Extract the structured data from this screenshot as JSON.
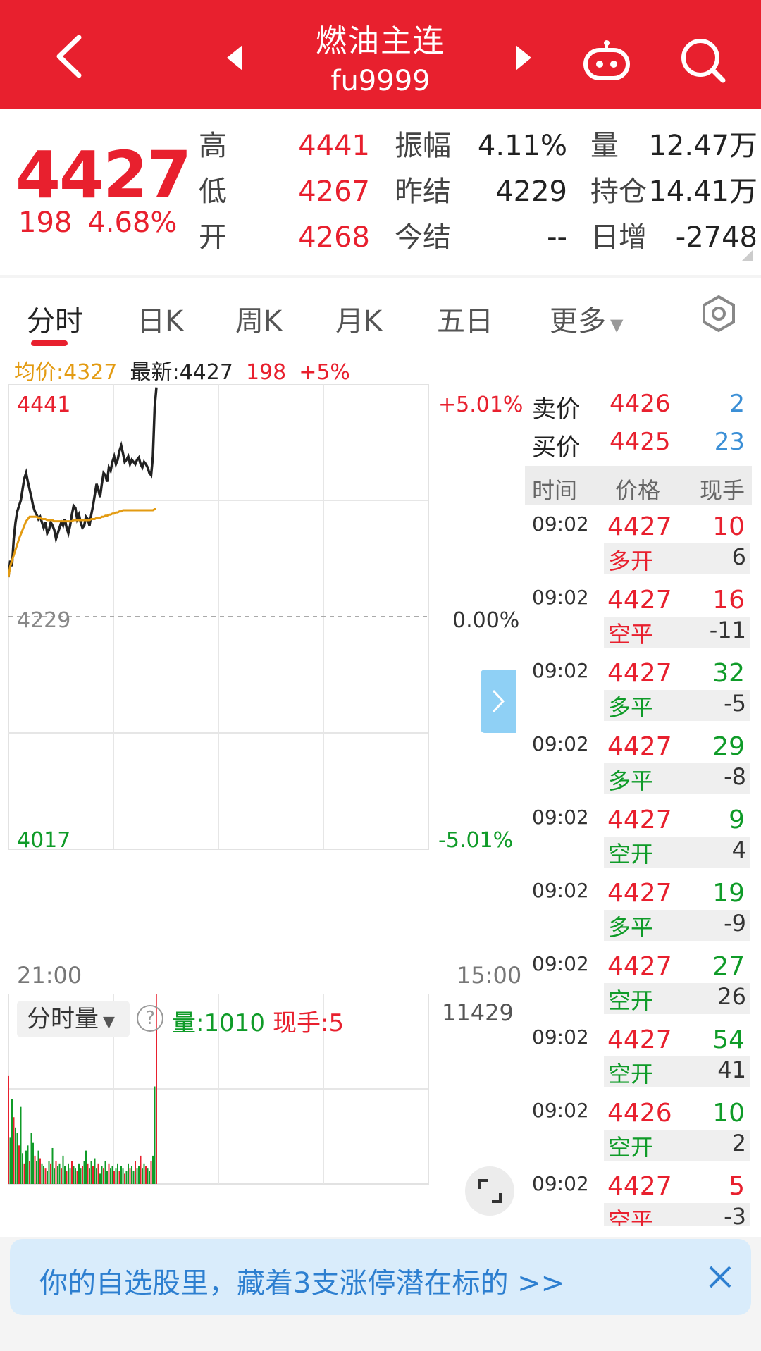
{
  "header": {
    "title": "燃油主连",
    "code": "fu9999",
    "icons": [
      "back-icon",
      "prev-arrow-icon",
      "next-arrow-icon",
      "robot-icon",
      "search-icon"
    ]
  },
  "quote": {
    "price": "4427",
    "change": "198",
    "change_pct": "4.68%",
    "rows": [
      {
        "l1": "高",
        "v1": "4441",
        "l2": "振幅",
        "v2": "4.11%",
        "l3": "量",
        "v3": "12.47万"
      },
      {
        "l1": "低",
        "v1": "4267",
        "l2": "昨结",
        "v2": "4229",
        "l3": "持仓",
        "v3": "14.41万"
      },
      {
        "l1": "开",
        "v1": "4268",
        "l2": "今结",
        "v2": "--",
        "l3": "日增",
        "v3": "-2748"
      }
    ]
  },
  "tabs": [
    "分时",
    "日K",
    "周K",
    "月K",
    "五日",
    "更多"
  ],
  "legend": {
    "avg": "均价:4327",
    "latest": "最新:4427",
    "chg": "198",
    "pct": "+5%"
  },
  "chart": {
    "y_high": "4441",
    "y_mid": "4229",
    "y_low": "4017",
    "pct_high": "+5.01%",
    "pct_mid": "0.00%",
    "pct_low": "-5.01%",
    "t_start": "21:00",
    "t_end": "15:00"
  },
  "volume": {
    "selector": "分时量",
    "qty": "量:1010",
    "hand": "现手:5",
    "max": "11429"
  },
  "orderbook": {
    "sell_label": "卖价",
    "sell_price": "4426",
    "sell_qty": "2",
    "buy_label": "买价",
    "buy_price": "4425",
    "buy_qty": "23",
    "col_time": "时间",
    "col_price": "价格",
    "col_qty": "现手"
  },
  "trades": [
    {
      "time": "09:02",
      "price": "4427",
      "qty": "10",
      "qty_color": "red",
      "type": "多开",
      "type_color": "red",
      "net": "6"
    },
    {
      "time": "09:02",
      "price": "4427",
      "qty": "16",
      "qty_color": "red",
      "type": "空平",
      "type_color": "red",
      "net": "-11"
    },
    {
      "time": "09:02",
      "price": "4427",
      "qty": "32",
      "qty_color": "green",
      "type": "多平",
      "type_color": "green",
      "net": "-5"
    },
    {
      "time": "09:02",
      "price": "4427",
      "qty": "29",
      "qty_color": "green",
      "type": "多平",
      "type_color": "green",
      "net": "-8"
    },
    {
      "time": "09:02",
      "price": "4427",
      "qty": "9",
      "qty_color": "green",
      "type": "空开",
      "type_color": "green",
      "net": "4"
    },
    {
      "time": "09:02",
      "price": "4427",
      "qty": "19",
      "qty_color": "green",
      "type": "多平",
      "type_color": "green",
      "net": "-9"
    },
    {
      "time": "09:02",
      "price": "4427",
      "qty": "27",
      "qty_color": "green",
      "type": "空开",
      "type_color": "green",
      "net": "26"
    },
    {
      "time": "09:02",
      "price": "4427",
      "qty": "54",
      "qty_color": "green",
      "type": "空开",
      "type_color": "green",
      "net": "41"
    },
    {
      "time": "09:02",
      "price": "4426",
      "qty": "10",
      "qty_color": "green",
      "type": "空开",
      "type_color": "green",
      "net": "2"
    },
    {
      "time": "09:02",
      "price": "4427",
      "qty": "5",
      "qty_color": "red",
      "type": "空平",
      "type_color": "red",
      "net": "-3"
    }
  ],
  "banner": {
    "text": "你的自选股里，藏着3支涨停潜在标的 >>"
  },
  "colors": {
    "brand_red": "#e8202e",
    "green": "#0f9b28",
    "avg_line": "#e39b12",
    "blue": "#3b8fd6"
  },
  "chart_data": {
    "type": "line",
    "title": "",
    "xlabel": "",
    "ylabel": "",
    "ylim": [
      4017,
      4441
    ],
    "x_ticks": [
      "21:00",
      "15:00"
    ],
    "series": [
      {
        "name": "最新",
        "values": [
          4265,
          4280,
          4275,
          4300,
          4315,
          4325,
          4330,
          4335,
          4345,
          4355,
          4360,
          4352,
          4345,
          4338,
          4330,
          4325,
          4322,
          4318,
          4320,
          4315,
          4310,
          4315,
          4305,
          4308,
          4315,
          4312,
          4308,
          4300,
          4305,
          4310,
          4315,
          4312,
          4318,
          4310,
          4305,
          4312,
          4322,
          4330,
          4328,
          4318,
          4322,
          4315,
          4310,
          4312,
          4320,
          4318,
          4312,
          4322,
          4330,
          4340,
          4350,
          4345,
          4338,
          4350,
          4360,
          4358,
          4352,
          4365,
          4362,
          4370,
          4375,
          4368,
          4372,
          4380,
          4385,
          4378,
          4370,
          4372,
          4375,
          4368,
          4372,
          4370,
          4368,
          4372,
          4374,
          4368,
          4365,
          4370,
          4368,
          4365,
          4360,
          4358,
          4375,
          4420,
          4438
        ]
      },
      {
        "name": "均价",
        "values": [
          4265,
          4275,
          4280,
          4285,
          4290,
          4295,
          4300,
          4304,
          4308,
          4312,
          4316,
          4318,
          4320,
          4320,
          4320,
          4320,
          4320,
          4319,
          4319,
          4318,
          4318,
          4318,
          4317,
          4317,
          4317,
          4317,
          4316,
          4316,
          4316,
          4316,
          4316,
          4316,
          4316,
          4316,
          4316,
          4316,
          4316,
          4317,
          4317,
          4317,
          4317,
          4317,
          4317,
          4317,
          4317,
          4317,
          4317,
          4318,
          4318,
          4318,
          4319,
          4319,
          4319,
          4320,
          4320,
          4321,
          4321,
          4322,
          4322,
          4323,
          4323,
          4324,
          4324,
          4325,
          4325,
          4326,
          4326,
          4326,
          4326,
          4326,
          4326,
          4326,
          4326,
          4326,
          4326,
          4326,
          4326,
          4326,
          4326,
          4326,
          4326,
          4326,
          4326,
          4327,
          4327
        ]
      }
    ],
    "volume": [
      420,
      180,
      330,
      260,
      220,
      200,
      150,
      300,
      120,
      80,
      130,
      150,
      90,
      200,
      160,
      110,
      90,
      130,
      100,
      80,
      70,
      60,
      50,
      90,
      80,
      140,
      60,
      90,
      70,
      80,
      60,
      110,
      70,
      50,
      80,
      60,
      90,
      70,
      60,
      50,
      80,
      60,
      70,
      90,
      130,
      80,
      60,
      90,
      70,
      100,
      60,
      80,
      40,
      70,
      60,
      90,
      50,
      80,
      60,
      70,
      50,
      60,
      80,
      50,
      70,
      60,
      40,
      50,
      80,
      60,
      70,
      50,
      90,
      60,
      70,
      110,
      60,
      80,
      70,
      60,
      50,
      90,
      110,
      380,
      600
    ]
  }
}
